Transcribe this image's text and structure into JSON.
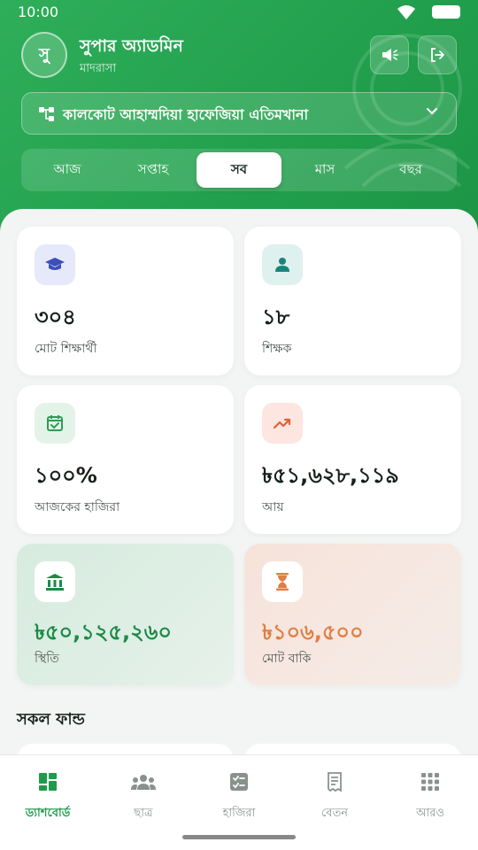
{
  "status_bar": {
    "time": "10:00"
  },
  "header": {
    "avatar_initial": "সু",
    "user_name": "সুপার অ্যাডমিন",
    "user_role": "মাদরাসা",
    "institution": "কালকোট আহাম্মদিয়া হাফেজিয়া এতিমখানা"
  },
  "tabs": [
    {
      "label": "আজ",
      "active": false
    },
    {
      "label": "সপ্তাহ",
      "active": false
    },
    {
      "label": "সব",
      "active": true
    },
    {
      "label": "মাস",
      "active": false
    },
    {
      "label": "বছর",
      "active": false
    }
  ],
  "stats": [
    {
      "value": "৩০৪",
      "label": "মোট শিক্ষার্থী",
      "icon": "graduation-cap-icon",
      "color": "#3b4fb8"
    },
    {
      "value": "১৮",
      "label": "শিক্ষক",
      "icon": "person-icon",
      "color": "#19857a"
    },
    {
      "value": "১০০%",
      "label": "আজকের হাজিরা",
      "icon": "calendar-check-icon",
      "color": "#2e9c53"
    },
    {
      "value": "৳৫১,৬২৮,১১৯",
      "label": "আয়",
      "icon": "trending-up-icon",
      "color": "#e0603a"
    },
    {
      "value": "৳৫০,১২৫,২৬০",
      "label": "স্থিতি",
      "icon": "bank-icon",
      "color": "#1c8a46"
    },
    {
      "value": "৳১০৬,৫০০",
      "label": "মোট বাকি",
      "icon": "hourglass-icon",
      "color": "#e07e43"
    }
  ],
  "section": {
    "funds_title": "সকল ফান্ড"
  },
  "bottom_nav": [
    {
      "label": "ড্যাশবোর্ড",
      "icon": "dashboard-icon",
      "active": true
    },
    {
      "label": "ছাত্র",
      "icon": "students-icon",
      "active": false
    },
    {
      "label": "হাজিরা",
      "icon": "attendance-icon",
      "active": false
    },
    {
      "label": "বেতন",
      "icon": "salary-receipt-icon",
      "active": false
    },
    {
      "label": "আরও",
      "icon": "more-grid-icon",
      "active": false
    }
  ],
  "colors": {
    "brand_green": "#22a04d",
    "nav_active": "#1e9a4b",
    "nav_inactive": "#8a918d"
  }
}
